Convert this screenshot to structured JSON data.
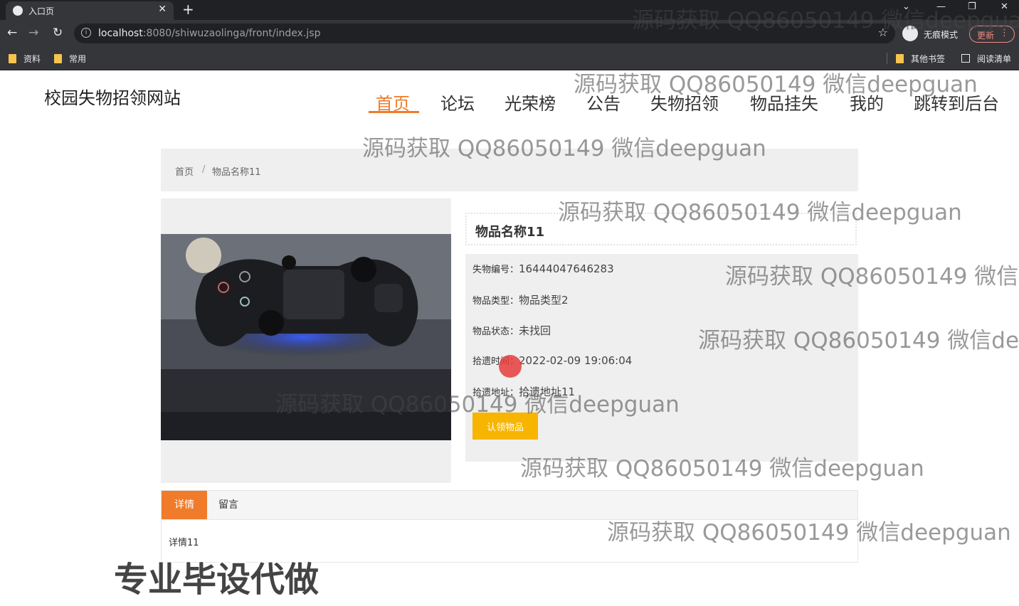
{
  "browser": {
    "tab_title": "入口页",
    "url_host": "localhost",
    "url_rest": ":8080/shiwuzaolinga/front/index.jsp",
    "incognito_label": "无痕模式",
    "update_label": "更新",
    "bookmarks": [
      "资料",
      "常用"
    ],
    "other_bookmarks": "其他书签",
    "reading_list": "阅读清单"
  },
  "site": {
    "title": "校园失物招领网站",
    "nav": [
      "首页",
      "论坛",
      "光荣榜",
      "公告",
      "失物招领",
      "物品挂失",
      "我的",
      "跳转到后台"
    ]
  },
  "breadcrumb": {
    "home": "首页",
    "sep": "/",
    "current": "物品名称11"
  },
  "item": {
    "name": "物品名称11",
    "fields": [
      {
        "label": "失物编号：",
        "value": "16444047646283"
      },
      {
        "label": "物品类型：",
        "value": "物品类型2"
      },
      {
        "label": "物品状态：",
        "value": "未找回"
      },
      {
        "label": "拾遗时间：",
        "value": "2022-02-09 19:06:04"
      },
      {
        "label": "拾遗地址：",
        "value": "拾遗地址11"
      }
    ],
    "claim_button": "认领物品"
  },
  "tabs": {
    "detail": "详情",
    "message": "留言",
    "content": "详情11"
  },
  "watermark": "源码获取 QQ86050149 微信deepguan",
  "promo": "专业毕设代做",
  "colors": {
    "accent": "#f07b2a",
    "button": "#f7b500"
  }
}
